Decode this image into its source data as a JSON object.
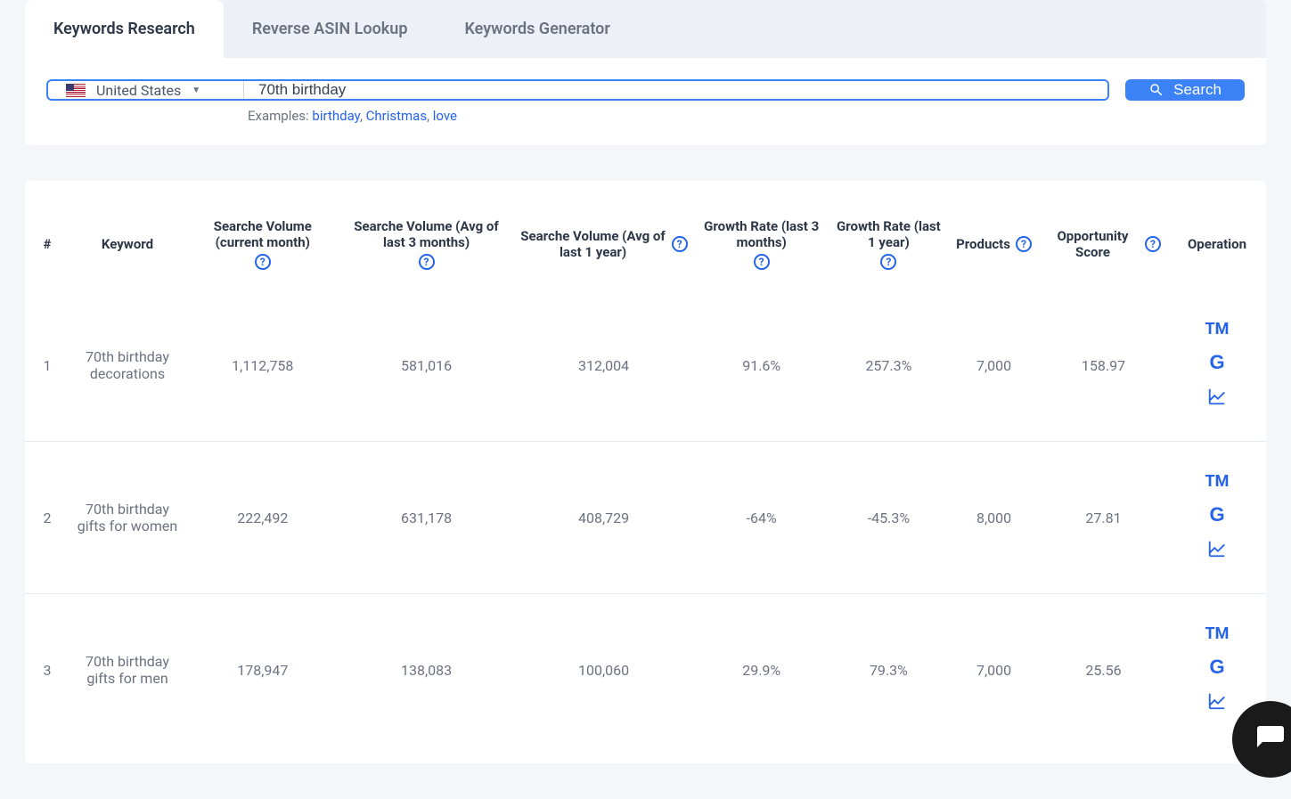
{
  "tabs": {
    "research": "Keywords Research",
    "reverse": "Reverse ASIN Lookup",
    "generator": "Keywords Generator"
  },
  "search": {
    "country": "United States",
    "keyword_value": "70th birthday",
    "button": "Search",
    "examples_label": "Examples:",
    "examples": [
      "birthday",
      "Christmas",
      "love"
    ]
  },
  "table": {
    "headers": {
      "num": "#",
      "keyword": "Keyword",
      "vol_current": "Searche Volume (current month)",
      "vol_3mo": "Searche Volume (Avg of last 3 months)",
      "vol_1yr": "Searche Volume (Avg of last 1 year)",
      "growth_3mo": "Growth Rate (last 3 months)",
      "growth_1yr": "Growth Rate (last 1 year)",
      "products": "Products",
      "opp_score": "Opportunity Score",
      "operation": "Operation"
    },
    "rows": [
      {
        "num": "1",
        "keyword": "70th birthday decorations",
        "vol_current": "1,112,758",
        "vol_3mo": "581,016",
        "vol_1yr": "312,004",
        "growth_3mo": "91.6%",
        "growth_1yr": "257.3%",
        "products": "7,000",
        "opp_score": "158.97"
      },
      {
        "num": "2",
        "keyword": "70th birthday gifts for women",
        "vol_current": "222,492",
        "vol_3mo": "631,178",
        "vol_1yr": "408,729",
        "growth_3mo": "-64%",
        "growth_1yr": "-45.3%",
        "products": "8,000",
        "opp_score": "27.81"
      },
      {
        "num": "3",
        "keyword": "70th birthday gifts for men",
        "vol_current": "178,947",
        "vol_3mo": "138,083",
        "vol_1yr": "100,060",
        "growth_3mo": "29.9%",
        "growth_1yr": "79.3%",
        "products": "7,000",
        "opp_score": "25.56"
      }
    ],
    "op_labels": {
      "tm": "TM",
      "google": "G",
      "trend": "trend"
    }
  }
}
